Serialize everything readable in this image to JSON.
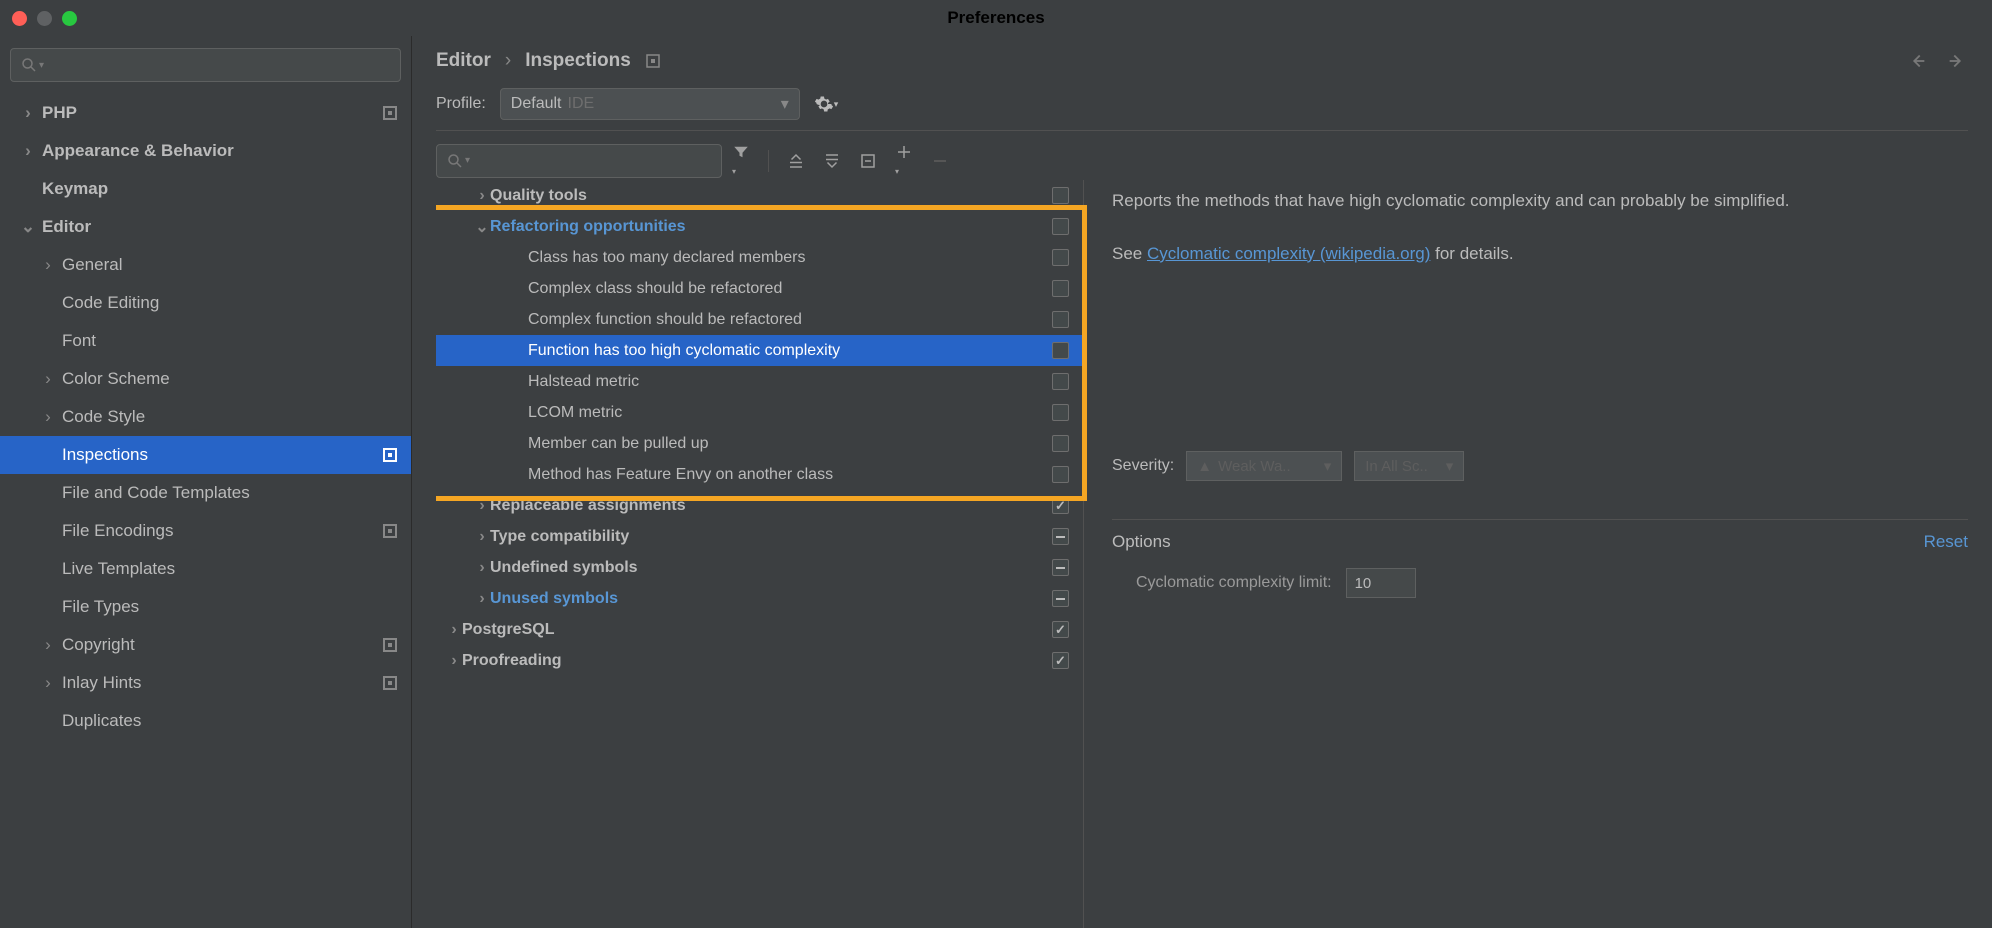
{
  "window": {
    "title": "Preferences"
  },
  "sidebar": {
    "items": [
      {
        "label": "PHP",
        "bold": true,
        "chev": "right",
        "indent": 0,
        "mod": true
      },
      {
        "label": "Appearance & Behavior",
        "bold": true,
        "chev": "right",
        "indent": 0
      },
      {
        "label": "Keymap",
        "bold": true,
        "chev": "none",
        "indent": 0
      },
      {
        "label": "Editor",
        "bold": true,
        "chev": "down",
        "indent": 0
      },
      {
        "label": "General",
        "chev": "right",
        "indent": 1
      },
      {
        "label": "Code Editing",
        "chev": "none",
        "indent": 1
      },
      {
        "label": "Font",
        "chev": "none",
        "indent": 1
      },
      {
        "label": "Color Scheme",
        "chev": "right",
        "indent": 1
      },
      {
        "label": "Code Style",
        "chev": "right",
        "indent": 1
      },
      {
        "label": "Inspections",
        "chev": "none",
        "indent": 1,
        "selected": true,
        "mod": true
      },
      {
        "label": "File and Code Templates",
        "chev": "none",
        "indent": 1
      },
      {
        "label": "File Encodings",
        "chev": "none",
        "indent": 1,
        "mod": true
      },
      {
        "label": "Live Templates",
        "chev": "none",
        "indent": 1
      },
      {
        "label": "File Types",
        "chev": "none",
        "indent": 1
      },
      {
        "label": "Copyright",
        "chev": "right",
        "indent": 1,
        "mod": true
      },
      {
        "label": "Inlay Hints",
        "chev": "right",
        "indent": 1,
        "mod": true
      },
      {
        "label": "Duplicates",
        "chev": "none",
        "indent": 1
      }
    ]
  },
  "breadcrumb": {
    "part1": "Editor",
    "part2": "Inspections"
  },
  "profile": {
    "label": "Profile:",
    "name": "Default",
    "suffix": "IDE"
  },
  "inspections": [
    {
      "label": "Quality tools",
      "lvl": 1,
      "bold": true,
      "chev": "right",
      "check": "empty"
    },
    {
      "label": "Refactoring opportunities",
      "lvl": 1,
      "link": true,
      "chev": "down",
      "check": "empty"
    },
    {
      "label": "Class has too many declared members",
      "lvl": 2,
      "check": "empty"
    },
    {
      "label": "Complex class should be refactored",
      "lvl": 2,
      "check": "empty"
    },
    {
      "label": "Complex function should be refactored",
      "lvl": 2,
      "check": "empty"
    },
    {
      "label": "Function has too high cyclomatic complexity",
      "lvl": 2,
      "selected": true,
      "check": "empty"
    },
    {
      "label": "Halstead metric",
      "lvl": 2,
      "check": "empty"
    },
    {
      "label": "LCOM metric",
      "lvl": 2,
      "check": "empty"
    },
    {
      "label": "Member can be pulled up",
      "lvl": 2,
      "check": "empty"
    },
    {
      "label": "Method has Feature Envy on another class",
      "lvl": 2,
      "check": "empty"
    },
    {
      "label": "Replaceable assignments",
      "lvl": 1,
      "bold": true,
      "chev": "right",
      "check": "checked"
    },
    {
      "label": "Type compatibility",
      "lvl": 1,
      "bold": true,
      "chev": "right",
      "check": "mixed"
    },
    {
      "label": "Undefined symbols",
      "lvl": 1,
      "bold": true,
      "chev": "right",
      "check": "mixed"
    },
    {
      "label": "Unused symbols",
      "lvl": 1,
      "link": true,
      "chev": "right",
      "check": "mixed"
    },
    {
      "label": "PostgreSQL",
      "lvl": 0,
      "bold": true,
      "chev": "right",
      "check": "checked"
    },
    {
      "label": "Proofreading",
      "lvl": 0,
      "bold": true,
      "chev": "right",
      "check": "checked"
    }
  ],
  "detail": {
    "text1": "Reports the methods that have high cyclomatic complexity and can probably be simplified.",
    "text2a": "See ",
    "link": "Cyclomatic complexity (wikipedia.org)",
    "text2b": " for details.",
    "severity_label": "Severity:",
    "severity_value": "Weak Wa..",
    "scope_value": "In All Sc..",
    "options_label": "Options",
    "reset_label": "Reset",
    "cyclo_label": "Cyclomatic complexity limit:",
    "cyclo_value": "10"
  }
}
